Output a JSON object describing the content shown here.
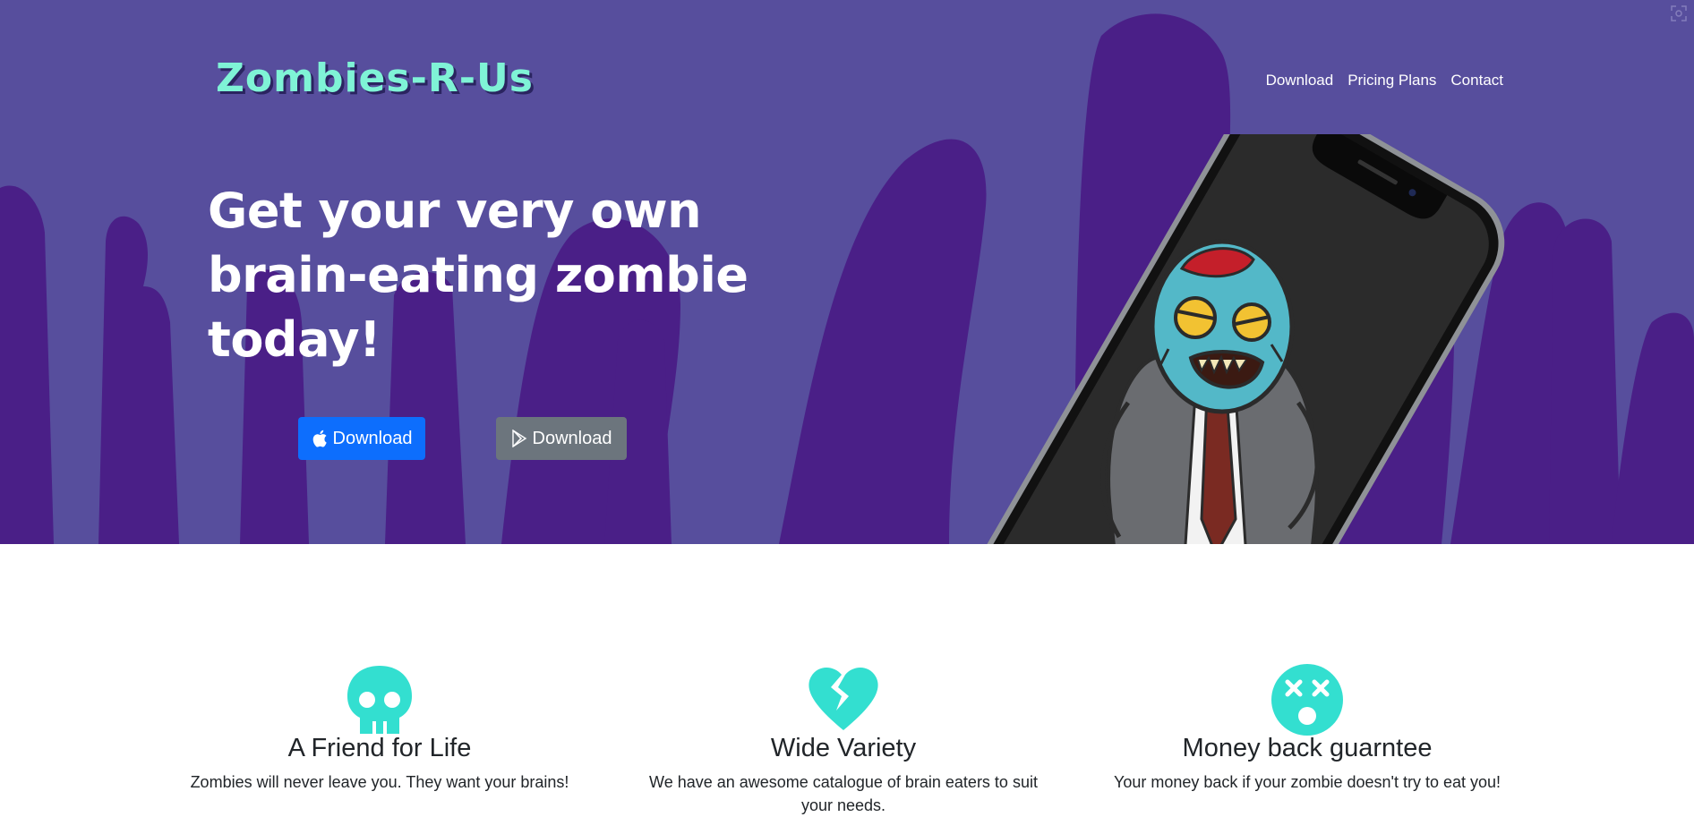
{
  "brand": {
    "name": "Zombies-R-Us"
  },
  "nav": {
    "items": [
      "Download",
      "Pricing Plans",
      "Contact"
    ]
  },
  "hero": {
    "headline_lines": [
      "Get your very own",
      "brain-eating zombie",
      "today!"
    ],
    "buttons": [
      {
        "label": "Download",
        "icon": "apple-icon",
        "color": "#0d6efd"
      },
      {
        "label": "Download",
        "icon": "google-play-icon",
        "color": "#6c757d"
      }
    ],
    "colors": {
      "background": "#574e9d",
      "drips": "#4a1f87",
      "brand": "#7ff3d6"
    }
  },
  "features": [
    {
      "icon": "skull-icon",
      "title": "A Friend for Life",
      "text": "Zombies will never leave you. They want your brains!"
    },
    {
      "icon": "broken-heart-icon",
      "title": "Wide Variety",
      "text": "We have an awesome catalogue of brain eaters to suit your needs."
    },
    {
      "icon": "dizzy-face-icon",
      "title": "Money back guarntee",
      "text": "Your money back if your zombie doesn't try to eat you!"
    }
  ],
  "feature_icon_color": "#33dfd0"
}
